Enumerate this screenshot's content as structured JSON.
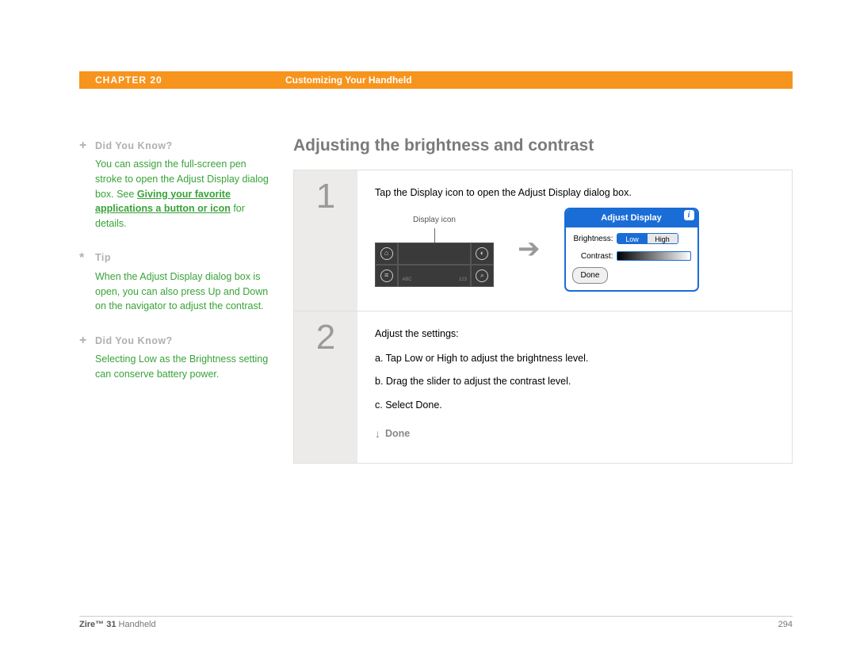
{
  "header": {
    "chapter": "CHAPTER 20",
    "title": "Customizing Your Handheld"
  },
  "section_title": "Adjusting the brightness and contrast",
  "sidebar": [
    {
      "glyph": "+",
      "head": "Did You Know?",
      "pre_text": "You can assign the full-screen pen stroke to open the Adjust Display dialog box. See ",
      "link_text": "Giving your favorite applications a button or icon",
      "post_text": " for details."
    },
    {
      "glyph": "*",
      "head": "Tip",
      "pre_text": "When the Adjust Display dialog box is open, you can also press Up and Down on the navigator to adjust the contrast.",
      "link_text": "",
      "post_text": ""
    },
    {
      "glyph": "+",
      "head": "Did You Know?",
      "pre_text": "Selecting Low as the Brightness setting can conserve battery power.",
      "link_text": "",
      "post_text": ""
    }
  ],
  "steps": {
    "s1": {
      "num": "1",
      "text": "Tap the Display icon to open the Adjust Display dialog box.",
      "icon_label": "Display icon",
      "dialog": {
        "title": "Adjust Display",
        "brightness_label": "Brightness:",
        "contrast_label": "Contrast:",
        "low": "Low",
        "high": "High",
        "done": "Done"
      }
    },
    "s2": {
      "num": "2",
      "intro": "Adjust the settings:",
      "a": "a.  Tap Low or High to adjust the brightness level.",
      "b": "b.  Drag the slider to adjust the contrast level.",
      "c": "c.  Select Done.",
      "done": "Done"
    }
  },
  "footer": {
    "product_bold": "Zire™ 31",
    "product_rest": " Handheld",
    "page": "294"
  }
}
